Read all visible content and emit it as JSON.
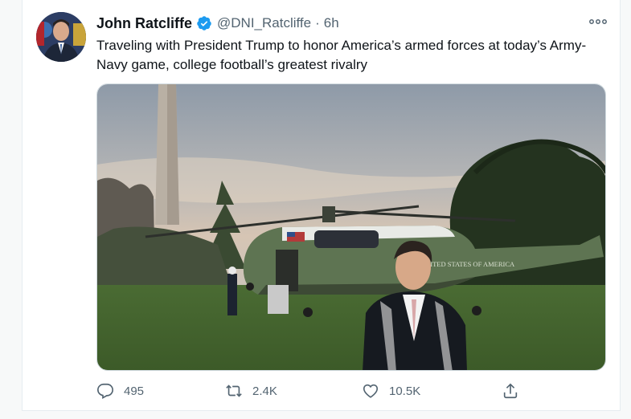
{
  "tweet": {
    "author": {
      "display_name": "John Ratcliffe",
      "handle": "@DNI_Ratcliffe",
      "verified": true
    },
    "separator": "·",
    "time": "6h",
    "text": "Traveling with President Trump to honor America’s armed forces at today’s Army-Navy game, college football’s greatest rivalry",
    "media": {
      "helicopter_text": "UNITED STATES OF AMERICA"
    },
    "actions": {
      "replies": "495",
      "retweets": "2.4K",
      "likes": "10.5K"
    },
    "icons": {
      "verified": "verified-badge-icon",
      "more": "more-options-icon",
      "reply": "reply-icon",
      "retweet": "retweet-icon",
      "like": "heart-icon",
      "share": "share-icon"
    },
    "colors": {
      "accent": "#1d9bf0",
      "secondary_text": "#536471"
    }
  }
}
